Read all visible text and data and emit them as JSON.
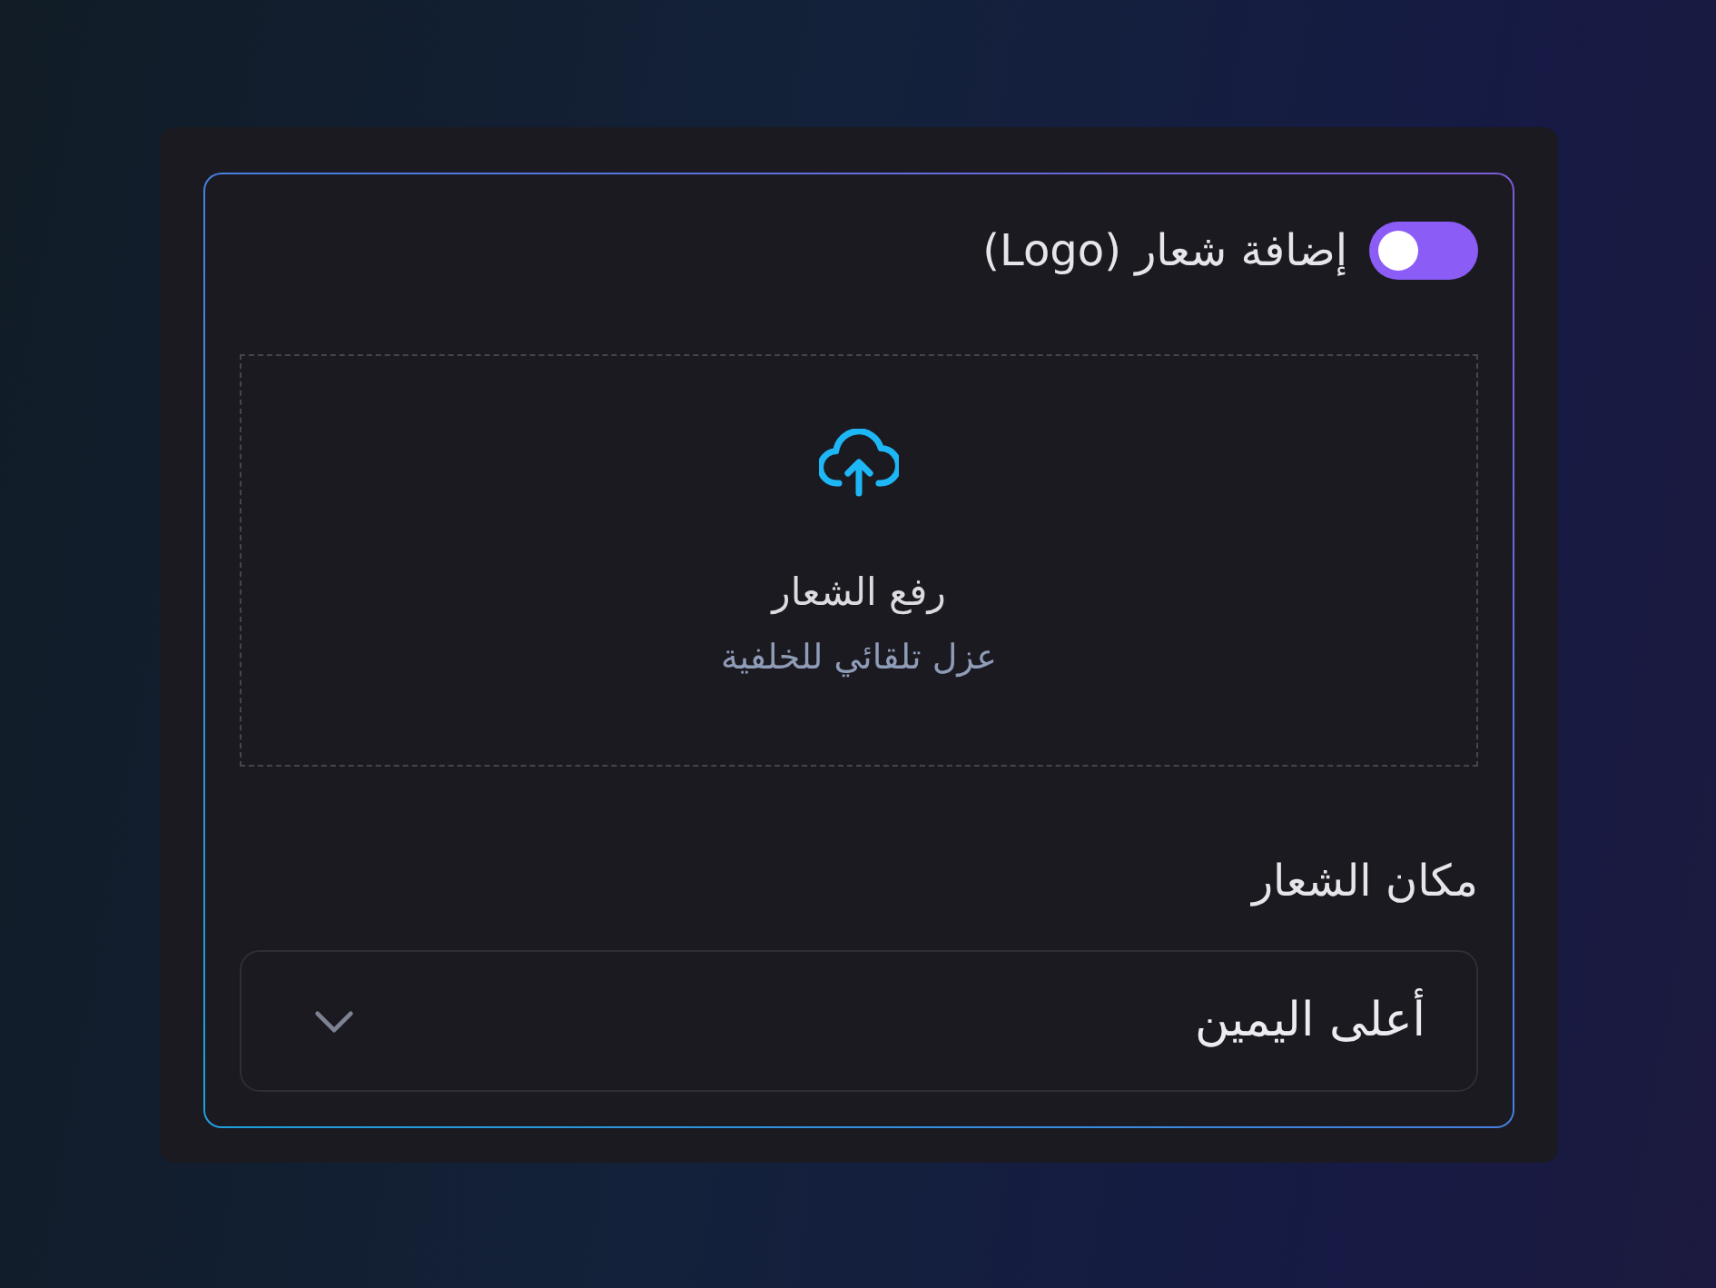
{
  "logo_toggle": {
    "label": "إضافة شعار (Logo)",
    "on": true
  },
  "upload": {
    "title": "رفع الشعار",
    "subtitle": "عزل تلقائي للخلفية"
  },
  "position": {
    "label": "مكان الشعار",
    "value": "أعلى اليمين"
  }
}
